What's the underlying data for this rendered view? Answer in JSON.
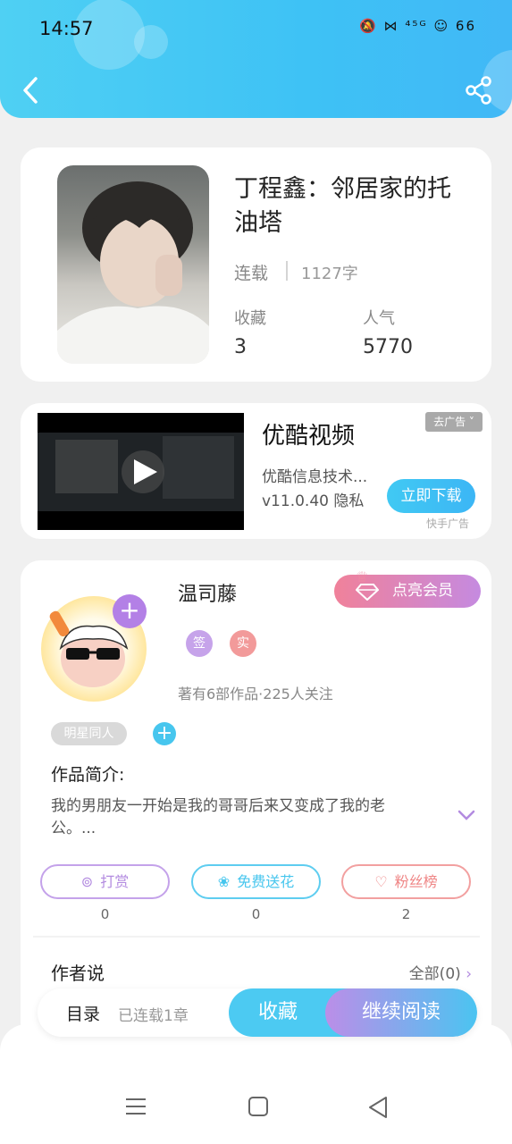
{
  "status_bar": {
    "time": "14:57",
    "icons": "🔕 ⋈ ⁴⁵ᴳ ☺ 66"
  },
  "book": {
    "title": "丁程鑫：邻居家的托油塔",
    "status": "连载",
    "words": "1127字",
    "favorites_label": "收藏",
    "favorites_value": "3",
    "popularity_label": "人气",
    "popularity_value": "5770"
  },
  "ad": {
    "title": "优酷视频",
    "company": "优酷信息技术...",
    "version": "v11.0.40  隐私",
    "remove_label": "去广告 ˅",
    "download_label": "立即下载",
    "source": "快手广告"
  },
  "author": {
    "name": "温司藤",
    "vip_label": "点亮会员",
    "badge_sign": "签",
    "badge_real": "实",
    "meta": "著有6部作品·225人关注",
    "genre_tag": "明星同人"
  },
  "intro": {
    "label": "作品简介:",
    "text": "我的男朋友一开始是我的哥哥后来又变成了我的老公。..."
  },
  "actions": [
    {
      "label": "打赏",
      "count": "0",
      "color": "#b38be0",
      "icon": "yen-icon"
    },
    {
      "label": "免费送花",
      "count": "0",
      "color": "#47c6ee",
      "icon": "flower-icon"
    },
    {
      "label": "粉丝榜",
      "count": "2",
      "color": "#f28a8a",
      "icon": "fan-icon"
    }
  ],
  "author_says": {
    "label": "作者说",
    "all_label": "全部(0)"
  },
  "bottom_bar": {
    "toc_label": "目录",
    "chapters_label": "已连载1章",
    "favorite_label": "收藏",
    "read_label": "继续阅读"
  }
}
